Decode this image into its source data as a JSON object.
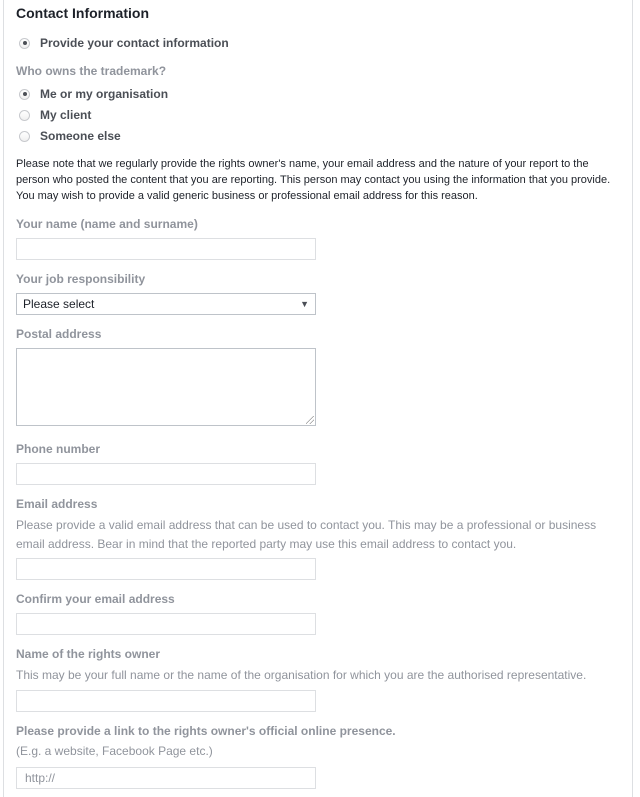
{
  "section": {
    "title": "Contact Information"
  },
  "contact_option": {
    "label": "Provide your contact information",
    "selected": true
  },
  "ownership": {
    "question": "Who owns the trademark?",
    "options": [
      {
        "label": "Me or my organisation",
        "selected": true
      },
      {
        "label": "My client",
        "selected": false
      },
      {
        "label": "Someone else",
        "selected": false
      }
    ]
  },
  "privacy_note": "Please note that we regularly provide the rights owner's name, your email address and the nature of your report to the person who posted the content that you are reporting. This person may contact you using the information that you provide. You may wish to provide a valid generic business or professional email address for this reason.",
  "fields": {
    "name": {
      "label": "Your name (name and surname)",
      "value": ""
    },
    "job": {
      "label": "Your job responsibility",
      "selected": "Please select"
    },
    "postal": {
      "label": "Postal address",
      "value": ""
    },
    "phone": {
      "label": "Phone number",
      "value": ""
    },
    "email": {
      "label": "Email address",
      "help": "Please provide a valid email address that can be used to contact you. This may be a professional or business email address. Bear in mind that the reported party may use this email address to contact you.",
      "value": ""
    },
    "confirm_email": {
      "label": "Confirm your email address",
      "value": ""
    },
    "rights_owner": {
      "label": "Name of the rights owner",
      "help": "This may be your full name or the name of the organisation for which you are the authorised representative.",
      "value": ""
    },
    "link": {
      "label": "Please provide a link to the rights owner's official online presence.",
      "help": "(E.g. a website, Facebook Page etc.)",
      "placeholder": "http://"
    }
  }
}
